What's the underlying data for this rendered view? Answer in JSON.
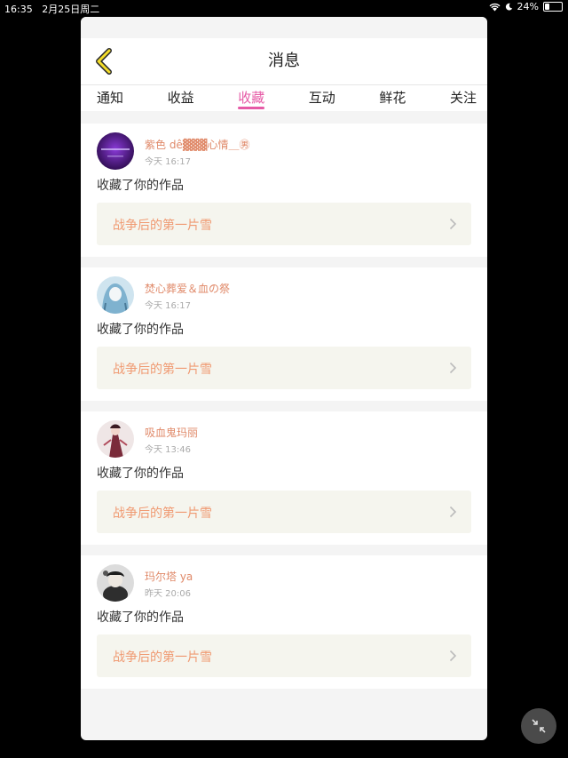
{
  "status_bar": {
    "time": "16:35",
    "date": "2月25日周二",
    "battery": "24%",
    "battery_level": 0.24
  },
  "header": {
    "title": "消息"
  },
  "tabs": [
    {
      "label": "通知",
      "active": false
    },
    {
      "label": "收益",
      "active": false
    },
    {
      "label": "收藏",
      "active": true
    },
    {
      "label": "互动",
      "active": false
    },
    {
      "label": "鲜花",
      "active": false
    },
    {
      "label": "关注",
      "active": false
    }
  ],
  "messages": [
    {
      "user": "紫色 dê▓▓▓心情＿㊚",
      "time": "今天 16:17",
      "action": "收藏了你的作品",
      "work": "战争后的第一片雪"
    },
    {
      "user": "焚心葬爱＆血の祭",
      "time": "今天 16:17",
      "action": "收藏了你的作品",
      "work": "战争后的第一片雪"
    },
    {
      "user": "吸血鬼玛丽",
      "time": "今天 13:46",
      "action": "收藏了你的作品",
      "work": "战争后的第一片雪"
    },
    {
      "user": "玛尔塔 ya",
      "time": "昨天 20:06",
      "action": "收藏了你的作品",
      "work": "战争后的第一片雪"
    }
  ],
  "colors": {
    "accent": "#e65aa6",
    "username": "#e08a6a",
    "work_title": "#f09a72"
  },
  "icons": {
    "back": "chevron-left-icon",
    "work_link": "chevron-right-icon",
    "fab": "collapse-icon"
  }
}
